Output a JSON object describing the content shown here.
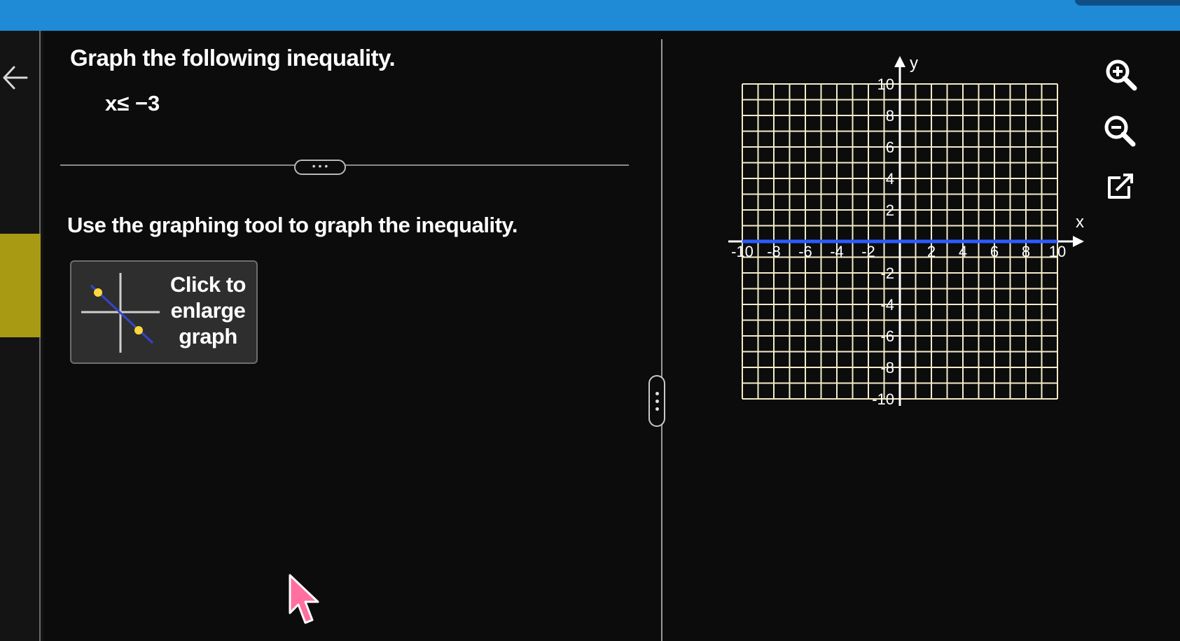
{
  "question": {
    "title": "Graph the following inequality.",
    "inequality": "x≤ −3",
    "instruction": "Use the graphing tool to graph the inequality."
  },
  "divider": {
    "handle_label": "• • •"
  },
  "enlarge_button": {
    "label_lines": [
      "Click to",
      "enlarge",
      "graph"
    ]
  },
  "graph": {
    "x_axis_label": "x",
    "y_axis_label": "y",
    "x_ticks": [
      "-10",
      "-8",
      "-6",
      "-4",
      "-2",
      "2",
      "4",
      "6",
      "8",
      "10"
    ],
    "y_ticks": [
      "10",
      "8",
      "6",
      "4",
      "2",
      "-2",
      "-4",
      "-6",
      "-8",
      "-10"
    ],
    "range": {
      "min": -10,
      "max": 10,
      "step": 1
    },
    "line_color": "#2a5cff",
    "grid_color": "#f3ecc8"
  },
  "tools": [
    "zoom-in-icon",
    "zoom-out-icon",
    "external-link-icon"
  ],
  "colors": {
    "top_bar": "#1f8ad6",
    "yellow_tab": "#a89a13",
    "background": "#0c0c0c"
  }
}
